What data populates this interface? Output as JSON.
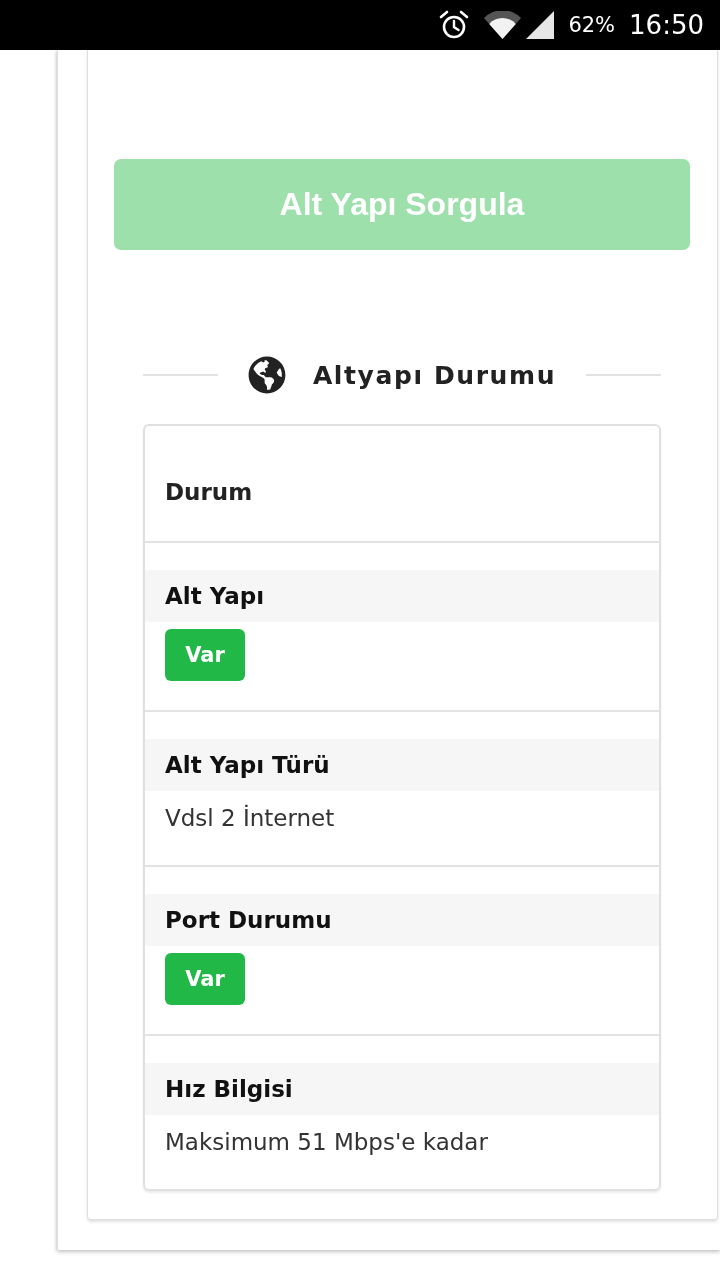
{
  "status_bar": {
    "battery": "62%",
    "time": "16:50"
  },
  "query_button": {
    "label": "Alt Yapı Sorgula"
  },
  "section": {
    "title": "Altyapı Durumu"
  },
  "table": {
    "header": "Durum",
    "rows": [
      {
        "label": "Alt Yapı",
        "kind": "badge",
        "value": "Var"
      },
      {
        "label": "Alt Yapı Türü",
        "kind": "text",
        "value": "Vdsl 2 İnternet"
      },
      {
        "label": "Port Durumu",
        "kind": "badge",
        "value": "Var"
      },
      {
        "label": "Hız Bilgisi",
        "kind": "text",
        "value": "Maksimum 51 Mbps'e kadar"
      }
    ]
  }
}
